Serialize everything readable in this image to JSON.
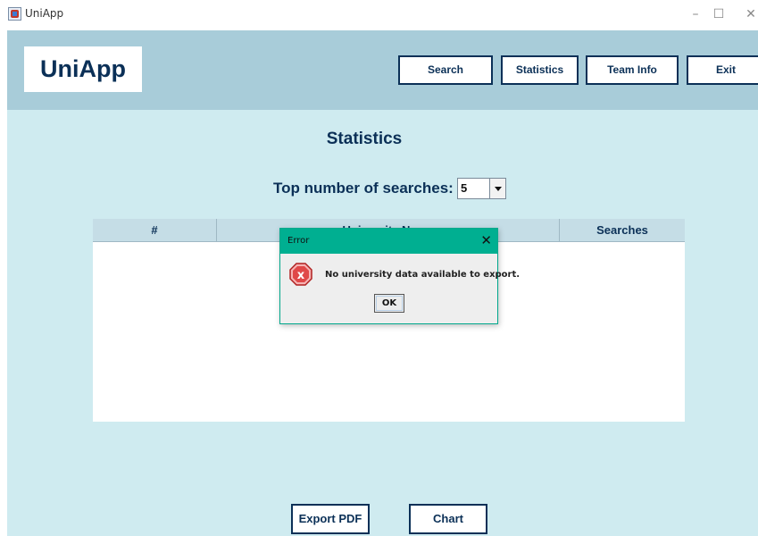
{
  "window": {
    "title": "UniApp",
    "minimize": "–",
    "maximize": "☐",
    "close": "✕"
  },
  "header": {
    "logo": "UniApp",
    "nav": {
      "search": "Search",
      "statistics": "Statistics",
      "team_info": "Team Info",
      "exit": "Exit"
    }
  },
  "main": {
    "title": "Statistics",
    "top_label": "Top number of searches:",
    "top_value": "5",
    "table": {
      "columns": [
        "#",
        "University Name",
        "Searches"
      ],
      "rows": []
    },
    "buttons": {
      "export_pdf": "Export PDF",
      "chart": "Chart"
    }
  },
  "dialog": {
    "title": "Error",
    "close": "✕",
    "message": "No university data available to export.",
    "ok": "OK",
    "icon": "error-icon"
  },
  "colors": {
    "header_bg": "#a8ccd9",
    "content_bg": "#cfebf0",
    "accent_navy": "#0b3057",
    "dialog_bar": "#00af91",
    "error_red": "#cc2222"
  }
}
